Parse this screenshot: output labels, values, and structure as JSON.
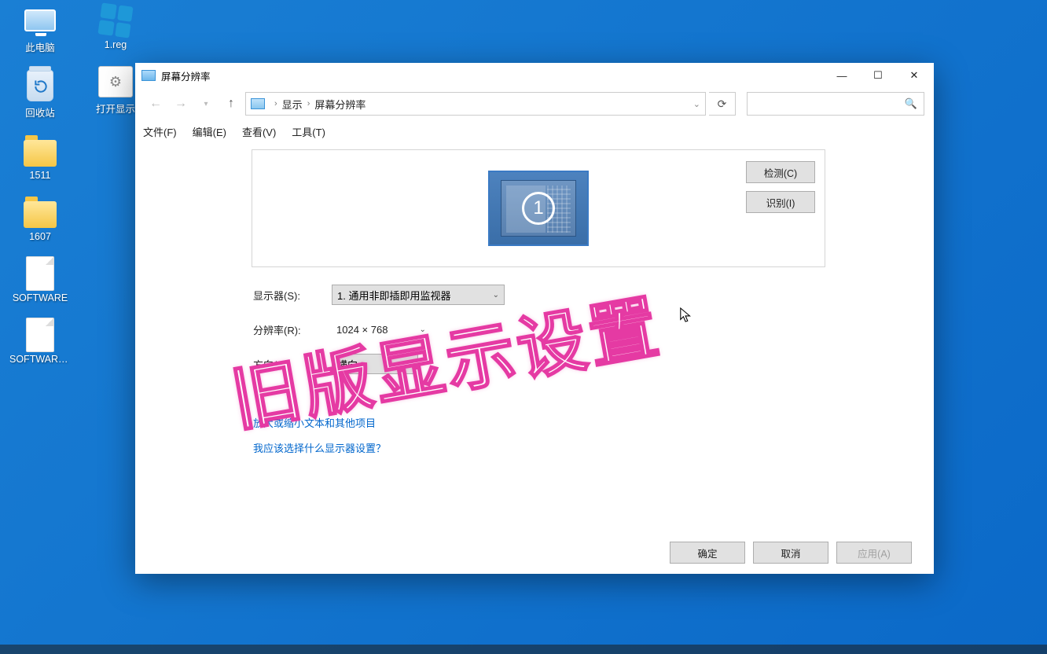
{
  "desktop": {
    "this_pc": "此电脑",
    "reg": "1.reg",
    "recycle": "回收站",
    "batch": "打开显示",
    "folder1": "1511",
    "folder2": "1607",
    "file1": "SOFTWARE",
    "file2": "SOFTWARE..."
  },
  "window": {
    "title": "屏幕分辨率",
    "breadcrumb": {
      "seg1": "显示",
      "seg2": "屏幕分辨率"
    },
    "menu": {
      "file": "文件(F)",
      "edit": "编辑(E)",
      "view": "查看(V)",
      "tools": "工具(T)"
    },
    "detect": "检测(C)",
    "identify": "识别(I)",
    "monitor_number": "1",
    "labels": {
      "display": "显示器(S):",
      "resolution": "分辨率(R):",
      "orientation": "方向(O):"
    },
    "values": {
      "display_sel": "1. 通用非即插即用监视器",
      "resolution_sel": "1024 × 768",
      "orientation_sel": "横向"
    },
    "link1_prefix": "放大或缩小文本和其他项目",
    "link2": "我应该选择什么显示器设置？",
    "buttons": {
      "ok": "确定",
      "cancel": "取消",
      "apply": "应用(A)"
    },
    "search_placeholder": ""
  },
  "overlay_text": "旧版显示设置"
}
